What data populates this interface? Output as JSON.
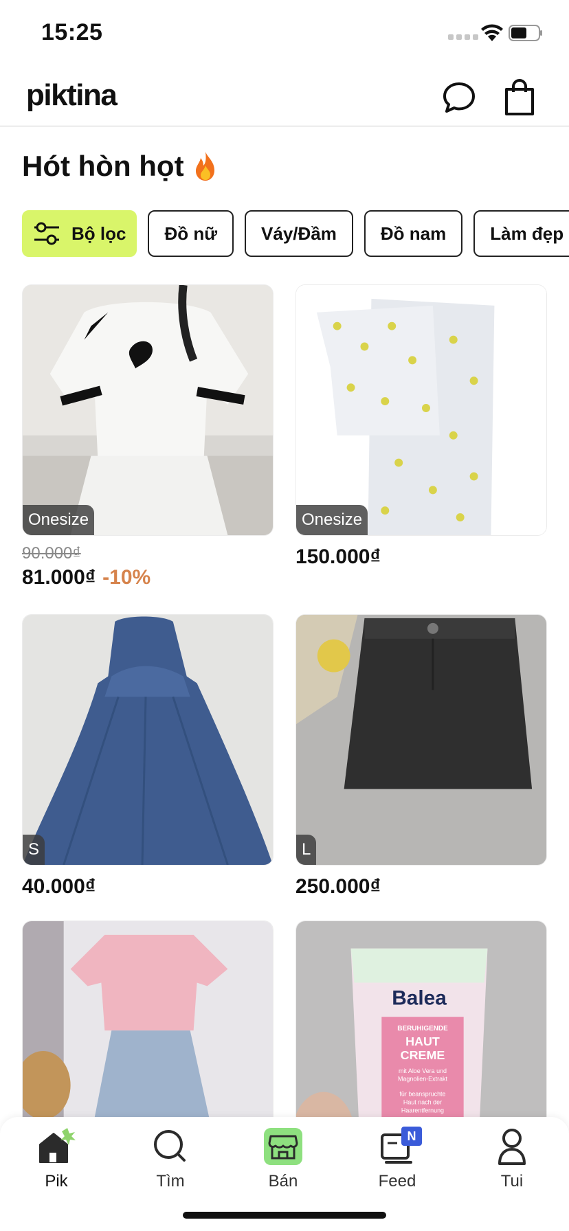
{
  "status_bar": {
    "time": "15:25"
  },
  "header": {
    "logo": "piktina"
  },
  "section": {
    "title": "Hót hòn họt"
  },
  "chips": [
    {
      "label": "Bộ lọc"
    },
    {
      "label": "Đồ nữ"
    },
    {
      "label": "Váy/Đầm"
    },
    {
      "label": "Đồ nam"
    },
    {
      "label": "Làm đẹp"
    }
  ],
  "products": [
    {
      "size": "Onesize",
      "old_price": "90.000₫",
      "price": "81.000₫",
      "discount": "-10%"
    },
    {
      "size": "Onesize",
      "price": "150.000₫"
    },
    {
      "size": "S",
      "price": "40.000₫"
    },
    {
      "size": "L",
      "price": "250.000₫"
    },
    {},
    {
      "product_text": {
        "brand": "Balea",
        "line1": "BERUHIGENDE",
        "line2": "HAUT",
        "line3": "CREME",
        "line4": "mit Aloe Vera und",
        "line5": "Magnolien-Extrakt",
        "line6": "für beanspruchte",
        "line7": "Haut nach der",
        "line8": "Haarentfernung"
      }
    }
  ],
  "bottom_nav": [
    {
      "label": "Pik",
      "icon": "home-icon",
      "active": true
    },
    {
      "label": "Tìm",
      "icon": "search-icon"
    },
    {
      "label": "Bán",
      "icon": "shop-icon"
    },
    {
      "label": "Feed",
      "icon": "feed-icon",
      "badge": "N"
    },
    {
      "label": "Tui",
      "icon": "profile-icon"
    }
  ],
  "colors": {
    "accent": "#d9f56a",
    "discount": "#d6834c",
    "badge": "#3a5bd9"
  }
}
